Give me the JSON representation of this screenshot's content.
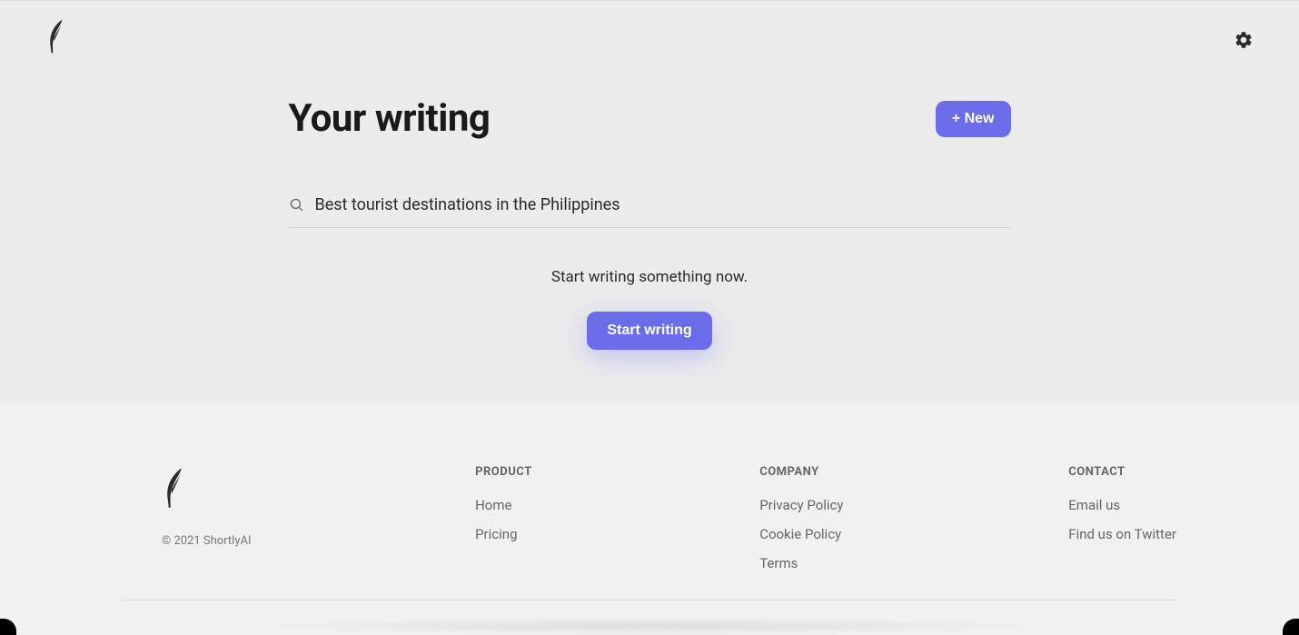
{
  "header": {
    "page_title": "Your writing",
    "new_button": "+ New"
  },
  "search": {
    "value": "Best tourist destinations in the Philippines"
  },
  "empty_state": {
    "text": "Start writing something now.",
    "button": "Start writing"
  },
  "footer": {
    "copyright": "©  2021 ShortlyAI",
    "columns": {
      "product": {
        "heading": "PRODUCT",
        "links": [
          "Home",
          "Pricing"
        ]
      },
      "company": {
        "heading": "COMPANY",
        "links": [
          "Privacy Policy",
          "Cookie Policy",
          "Terms"
        ]
      },
      "contact": {
        "heading": "CONTACT",
        "links": [
          "Email us",
          "Find us on Twitter"
        ]
      }
    }
  }
}
